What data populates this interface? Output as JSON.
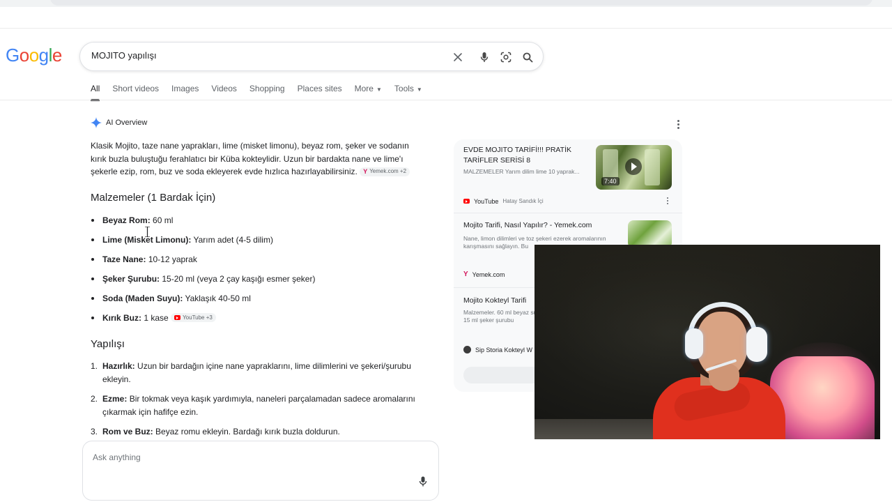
{
  "search": {
    "query": "MOJITO yapılışı",
    "logo_letters": [
      {
        "ch": "G",
        "color": "#4285F4"
      },
      {
        "ch": "o",
        "color": "#EA4335"
      },
      {
        "ch": "o",
        "color": "#FBBC05"
      },
      {
        "ch": "g",
        "color": "#4285F4"
      },
      {
        "ch": "l",
        "color": "#34A853"
      },
      {
        "ch": "e",
        "color": "#EA4335"
      }
    ],
    "icons": [
      "clear-icon",
      "mic-icon",
      "lens-icon",
      "search-icon"
    ]
  },
  "tabs": [
    {
      "label": "All",
      "active": true
    },
    {
      "label": "Short videos"
    },
    {
      "label": "Images"
    },
    {
      "label": "Videos"
    },
    {
      "label": "Shopping"
    },
    {
      "label": "Places sites"
    },
    {
      "label": "More",
      "dropdown": true
    },
    {
      "label": "Tools",
      "dropdown": true
    }
  ],
  "ai_overview": {
    "label": "AI Overview",
    "intro": "Klasik Mojito, taze nane yaprakları, lime (misket limonu), beyaz rom, şeker ve sodanın kırık buzla buluştuğu ferahlatıcı bir Küba kokteylidir. Uzun bir bardakta nane ve lime'ı şekerle ezip, rom, buz ve soda ekleyerek evde hızlıca hazırlayabilirsiniz.",
    "intro_chip": "Yemek.com +2",
    "ingredients_heading": "Malzemeler (1 Bardak İçin)",
    "ingredients": [
      {
        "name": "Beyaz Rom:",
        "value": "60 ml"
      },
      {
        "name": "Lime (Misket Limonu):",
        "value": "Yarım adet (4-5 dilim)"
      },
      {
        "name": "Taze Nane:",
        "value": "10-12 yaprak"
      },
      {
        "name": "Şeker Şurubu:",
        "value": "15-20 ml (veya 2 çay kaşığı esmer şeker)"
      },
      {
        "name": "Soda (Maden Suyu):",
        "value": "Yaklaşık 40-50 ml"
      },
      {
        "name": "Kırık Buz:",
        "value": "1 kase",
        "chip": "YouTube +3"
      }
    ],
    "steps_heading": "Yapılışı",
    "steps": [
      {
        "num": "1.",
        "name": "Hazırlık:",
        "text": "Uzun bir bardağın içine nane yapraklarını, lime dilimlerini ve şekeri/şurubu ekleyin."
      },
      {
        "num": "2.",
        "name": "Ezme:",
        "text": "Bir tokmak veya kaşık yardımıyla, naneleri parçalamadan sadece aromalarını çıkarmak için hafifçe ezin."
      },
      {
        "num": "3.",
        "name": "Rom ve Buz:",
        "text": "Beyaz romu ekleyin. Bardağı kırık buzla doldurun."
      }
    ]
  },
  "ask_box": {
    "placeholder": "Ask anything"
  },
  "side_panel": {
    "card1": {
      "title": "EVDE MOJITO TARİFİ!!! PRATİK TARİFLER SERİSİ 8",
      "snippet": "MALZEMELER Yarım dilim lime 10 yaprak...",
      "duration": "7:40",
      "source": "YouTube",
      "channel": "Hatay Sandık İçi"
    },
    "card2": {
      "title": "Mojito Tarifi, Nasıl Yapılır? - Yemek.com",
      "snippet": "Nane, limon dilimleri ve toz şekeri ezerek aromalarının karışmasını sağlayın. Bu",
      "source": "Yemek.com"
    },
    "card3": {
      "title": "Mojito Kokteyl Tarifi",
      "snippet": "Malzemeler. 60 ml beyaz su; 15 ml şeker şurubu",
      "source": "Sip Storia Kokteyl W"
    }
  },
  "colors": {
    "accent_blue": "#4285F4",
    "youtube_red": "#FF0000",
    "yemek_pink": "#D3155B",
    "text_primary": "#202124",
    "text_secondary": "#5F6368"
  }
}
